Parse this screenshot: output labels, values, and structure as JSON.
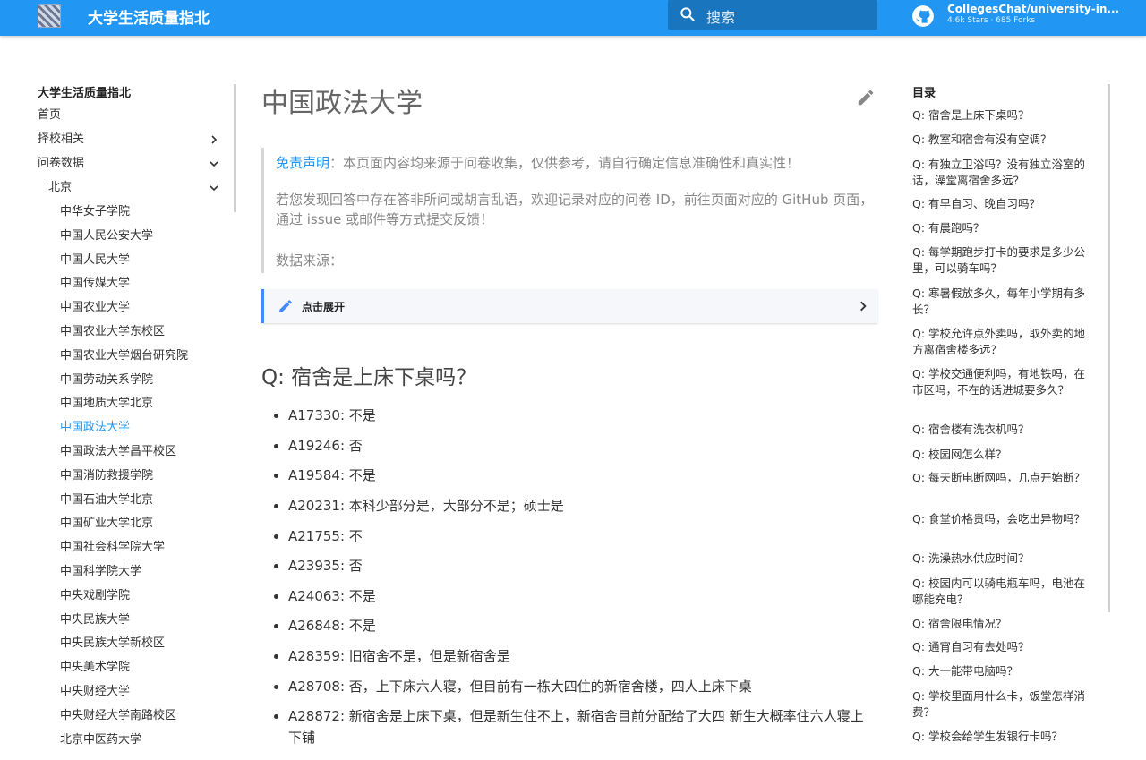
{
  "header": {
    "site_title": "大学生活质量指北",
    "search_placeholder": "搜索",
    "repo_name": "CollegesChat/university-in...",
    "repo_stats": "4.6k Stars · 685 Forks",
    "accent": "#2196f3"
  },
  "nav": {
    "title": "大学生活质量指北",
    "top_items": [
      {
        "label": "首页"
      },
      {
        "label": "择校相关"
      },
      {
        "label": "问卷数据"
      },
      {
        "label": "北京"
      }
    ],
    "schools": [
      "中华女子学院",
      "中国人民公安大学",
      "中国人民大学",
      "中国传媒大学",
      "中国农业大学",
      "中国农业大学东校区",
      "中国农业大学烟台研究院",
      "中国劳动关系学院",
      "中国地质大学北京",
      "中国政法大学",
      "中国政法大学昌平校区",
      "中国消防救援学院",
      "中国石油大学北京",
      "中国矿业大学北京",
      "中国社会科学院大学",
      "中国科学院大学",
      "中央戏剧学院",
      "中央民族大学",
      "中央民族大学新校区",
      "中央美术学院",
      "中央财经大学",
      "中央财经大学南路校区",
      "北京中医药大学"
    ],
    "active_school": "中国政法大学"
  },
  "main": {
    "title": "中国政法大学",
    "notice": {
      "disclaimer_link": "免责声明",
      "disclaimer_text": "：本页面内容均来源于问卷收集，仅供参考，请自行确定信息准确性和真实性！",
      "feedback_text": "若您发现回答中存在答非所问或胡言乱语，欢迎记录对应的问卷 ID，前往页面对应的 GitHub 页面，通过 issue 或邮件等方式提交反馈！",
      "source_text": "数据来源："
    },
    "details_label": "点击展开",
    "question": "Q: 宿舍是上床下桌吗？",
    "answers": [
      "A17330: 不是",
      "A19246: 否",
      "A19584: 不是",
      "A20231: 本科少部分是，大部分不是；硕士是",
      "A21755: 不",
      "A23935: 否",
      "A24063: 不是",
      "A26848: 不是",
      "A28359: 旧宿舍不是，但是新宿舍是",
      "A28708: 否，上下床六人寝，但目前有一栋大四住的新宿舍楼，四人上床下桌",
      "A28872: 新宿舍是上床下桌，但是新生住不上，新宿舍目前分配给了大四 新生大概率住六人寝上下铺"
    ]
  },
  "toc": {
    "title": "目录",
    "items": [
      "Q: 宿舍是上床下桌吗？",
      "Q: 教室和宿舍有没有空调？",
      "Q: 有独立卫浴吗？没有独立浴室的话，澡堂离宿舍多远？",
      "Q: 有早自习、晚自习吗？",
      "Q: 有晨跑吗？",
      "Q: 每学期跑步打卡的要求是多少公里，可以骑车吗？",
      "Q: 寒暑假放多久，每年小学期有多长？",
      "Q: 学校允许点外卖吗，取外卖的地方离宿舍楼多远？",
      "Q: 学校交通便利吗，有地铁吗，在市区吗，不在的话进城要多久？",
      "Q: 宿舍楼有洗衣机吗？",
      "Q: 校园网怎么样？",
      "Q: 每天断电断网吗，几点开始断？",
      "Q: 食堂价格贵吗，会吃出异物吗？",
      "Q: 洗澡热水供应时间？",
      "Q: 校园内可以骑电瓶车吗，电池在哪能充电？",
      "Q: 宿舍限电情况？",
      "Q: 通宵自习有去处吗？",
      "Q: 大一能带电脑吗？",
      "Q: 学校里面用什么卡，饭堂怎样消费？",
      "Q: 学校会给学生发银行卡吗？"
    ]
  }
}
